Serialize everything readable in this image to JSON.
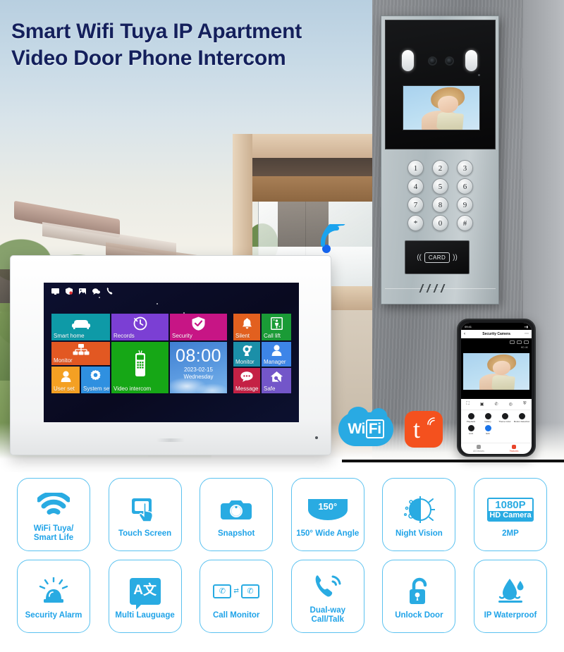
{
  "headline": {
    "line1": "Smart Wifi Tuya IP Apartment",
    "line2": "Video Door Phone Intercom",
    "color": "#14205c"
  },
  "door_station": {
    "keypad": {
      "keys": [
        "1",
        "2",
        "3",
        "4",
        "5",
        "6",
        "7",
        "8",
        "9",
        "*",
        "0",
        "#"
      ]
    },
    "rfid_label": "CARD"
  },
  "monitor": {
    "status_icons": [
      "monitor-icon",
      "shield-icon",
      "picture-icon",
      "chat-icon",
      "phone-icon"
    ],
    "clock": {
      "time": "08:00",
      "date": "2023-02-15",
      "day": "Wednesday"
    },
    "tiles": [
      {
        "label": "Smart home",
        "icon": "sofa-icon",
        "color": "#0e9aa7"
      },
      {
        "label": "Records",
        "icon": "clock-icon",
        "color": "#7b3fd4"
      },
      {
        "label": "Security",
        "icon": "shield-icon",
        "color": "#c71585"
      },
      {
        "label": "Monitor",
        "icon": "network-icon",
        "color": "#e25822"
      },
      {
        "label": "Video intercom",
        "icon": "handset-icon",
        "color": "#16a716"
      },
      {
        "label": "User set",
        "icon": "user-icon",
        "color": "#f4a023"
      },
      {
        "label": "System set",
        "icon": "gear-icon",
        "color": "#2f90e0"
      },
      {
        "label": "Silent",
        "icon": "bell-icon",
        "color": "#e2601f"
      },
      {
        "label": "Call lift",
        "icon": "elevator-icon",
        "color": "#1a9b36"
      },
      {
        "label": "Monitor",
        "icon": "camera-icon",
        "color": "#1b8fa8"
      },
      {
        "label": "Manager",
        "icon": "person-icon",
        "color": "#3d85e8"
      },
      {
        "label": "Message",
        "icon": "message-icon",
        "color": "#c42145"
      },
      {
        "label": "Safe",
        "icon": "home-lock-icon",
        "color": "#7356c9"
      }
    ]
  },
  "phone": {
    "status_time": "09:41",
    "app_title": "Security Camera",
    "resolution": "HD 4K",
    "toolbar_icons": [
      "fullscreen-icon",
      "screenshot-icon",
      "call-icon",
      "record-icon",
      "shield-icon"
    ],
    "grid": [
      {
        "label": "Playback",
        "icon": "playback-icon"
      },
      {
        "label": "Gallery",
        "icon": "gallery-icon"
      },
      {
        "label": "Theme Color",
        "icon": "theme-icon"
      },
      {
        "label": "Motion Detection",
        "icon": "motion-icon"
      },
      {
        "label": "Lock",
        "icon": "lock-icon"
      },
      {
        "label": "Edit",
        "icon": "edit-icon"
      }
    ],
    "tabs": [
      {
        "label": "All Devices",
        "icon": "devices-icon",
        "active": false
      },
      {
        "label": "Features",
        "icon": "features-icon",
        "active": true
      }
    ]
  },
  "logos": {
    "wifi": {
      "text_a": "Wi",
      "text_b": "Fi",
      "color": "#29aae3"
    },
    "tuya": {
      "glyph": "t",
      "color": "#f4511e"
    }
  },
  "features": {
    "accent": "#1fa3e8",
    "border": "#5bc2f0",
    "row1": [
      {
        "label": "WiFi Tuya/\nSmart Life",
        "icon": "wifi-icon"
      },
      {
        "label": "Touch Screen",
        "icon": "touch-screen-icon"
      },
      {
        "label": "Snapshot",
        "icon": "camera-icon"
      },
      {
        "label": "150° Wide Angle",
        "icon": "wide-angle-icon",
        "badge": "150°"
      },
      {
        "label": "Night Vision",
        "icon": "night-vision-icon"
      },
      {
        "label": "2MP",
        "icon": "hd-camera-icon",
        "badge_top": "1080P",
        "badge_bottom": "HD Camera"
      }
    ],
    "row2": [
      {
        "label": "Security Alarm",
        "icon": "alarm-siren-icon"
      },
      {
        "label": "Multi Lauguage",
        "icon": "translate-icon",
        "badge": "A文"
      },
      {
        "label": "Call Monitor",
        "icon": "call-monitor-icon"
      },
      {
        "label": "Dual-way\nCall/Talk",
        "icon": "phone-ring-icon"
      },
      {
        "label": "Unlock Door",
        "icon": "unlock-icon"
      },
      {
        "label": "IP Waterproof",
        "icon": "waterdrop-icon"
      }
    ]
  }
}
